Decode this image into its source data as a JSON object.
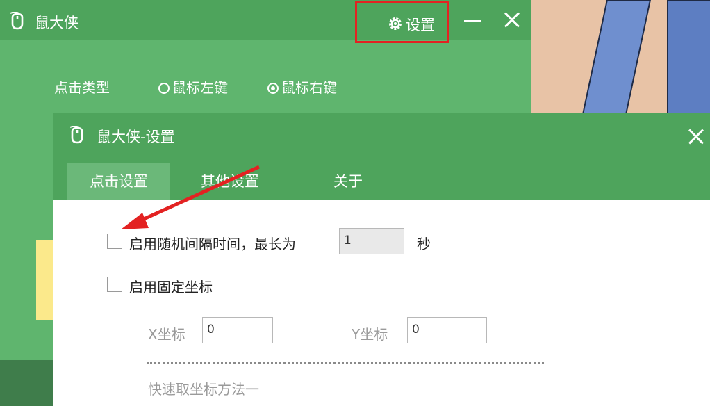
{
  "main_window": {
    "title": "鼠大侠",
    "settings_label": "设置",
    "click_type_label": "点击类型",
    "click_options": [
      {
        "label": "鼠标左键",
        "selected": false
      },
      {
        "label": "鼠标右键",
        "selected": true
      }
    ]
  },
  "settings_dialog": {
    "title": "鼠大侠-设置",
    "tabs": [
      {
        "label": "点击设置",
        "active": true
      },
      {
        "label": "其他设置",
        "active": false
      },
      {
        "label": "关于",
        "active": false
      }
    ],
    "random_interval": {
      "checked": false,
      "label": "启用随机间隔时间，最长为",
      "value": "1",
      "unit": "秒"
    },
    "fixed_coords": {
      "checked": false,
      "label": "启用固定坐标",
      "x_label": "X坐标",
      "x_value": "0",
      "y_label": "Y坐标",
      "y_value": "0"
    },
    "quick_method_label": "快速取坐标方法一"
  },
  "colors": {
    "titlebar_green": "#4ea45c",
    "window_green": "#5fb56e",
    "active_tab_green": "#6bb879",
    "highlight_red": "#e32222"
  },
  "icons": [
    "mouse-logo-icon",
    "gear-icon",
    "minimize-icon",
    "close-icon",
    "checkbox-icon",
    "radio-icon"
  ]
}
